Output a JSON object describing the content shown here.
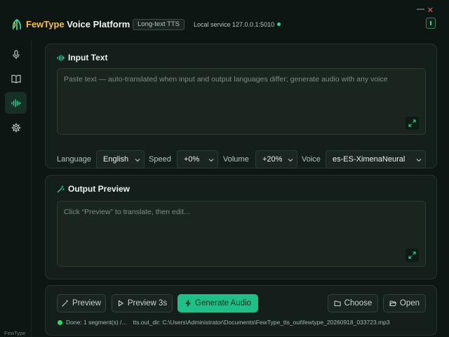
{
  "window": {
    "minimize_glyph": "—",
    "close_glyph": "✕"
  },
  "header": {
    "title_part1": "FewType",
    "title_part2": "Voice Platform",
    "mode_badge": "Long-text TTS",
    "service_text": "Local service 127.0.0.1:5010",
    "service_status_color": "#2fd89a"
  },
  "sidebar": {
    "items": [
      {
        "name": "microphone-icon",
        "active": false
      },
      {
        "name": "book-icon",
        "active": false
      },
      {
        "name": "waveform-icon",
        "active": true
      },
      {
        "name": "gear-icon",
        "active": false
      }
    ],
    "footer": "FewType"
  },
  "input_card": {
    "title": "Input Text",
    "placeholder": "Paste text — auto-translated when input and output languages differ; generate audio with any voice",
    "language_label": "Language",
    "language_value": "English",
    "speed_label": "Speed",
    "speed_value": "+0%",
    "volume_label": "Volume",
    "volume_value": "+20%",
    "voice_label": "Voice",
    "voice_value": "es-ES-XimenaNeural"
  },
  "output_card": {
    "title": "Output Preview",
    "placeholder": "Click “Preview” to translate, then edit..."
  },
  "actions": {
    "preview": "Preview",
    "preview3s": "Preview 3s",
    "generate": "Generate Audio",
    "choose": "Choose",
    "open": "Open",
    "status_text": "Done: 1 segment(s) /...",
    "out_dir": "tts.out_dir: C:\\Users\\Administrator\\Documents\\FewType_tts_out\\fewtype_20260918_033723.mp3"
  },
  "colors": {
    "accent": "#1fbf8a",
    "brand_yellow": "#f0c04a",
    "background": "#0e1613",
    "status_ok": "#37d65f"
  }
}
